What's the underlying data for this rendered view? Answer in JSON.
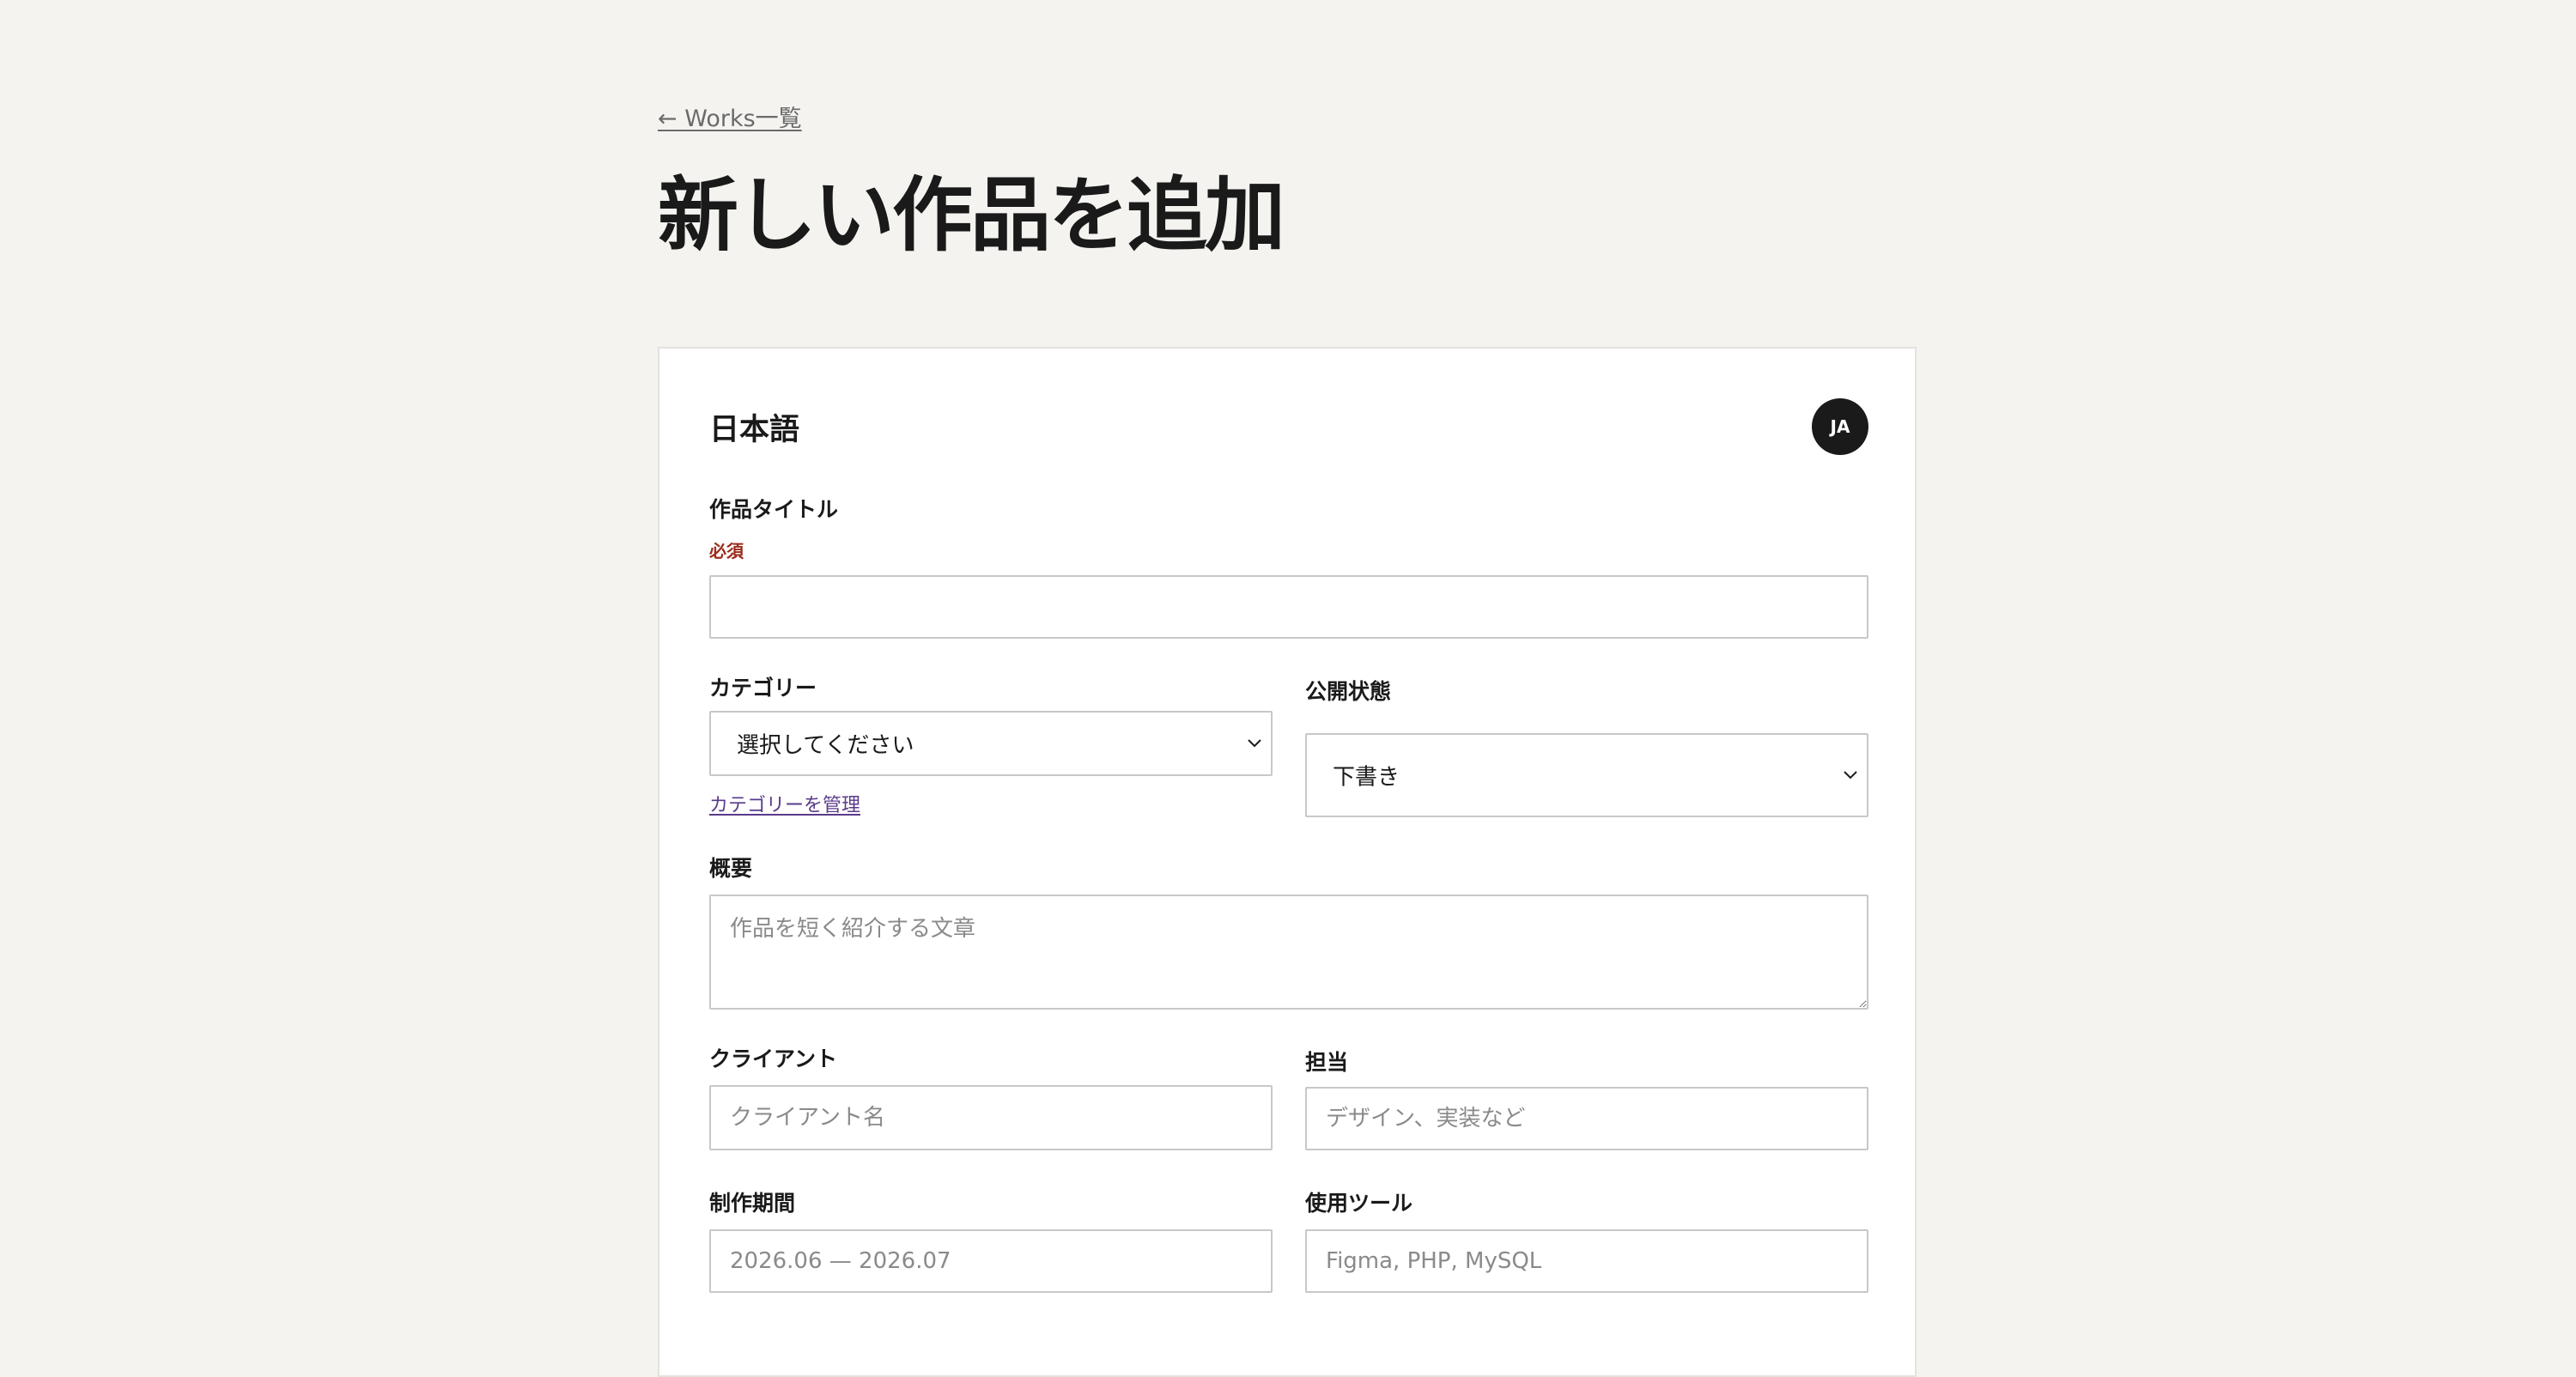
{
  "back_link": "← Works一覧",
  "page_title": "新しい作品を追加",
  "card": {
    "heading": "日本語",
    "lang_badge": "JA"
  },
  "fields": {
    "title": {
      "label": "作品タイトル",
      "required": "必須",
      "value": ""
    },
    "category": {
      "label": "カテゴリー",
      "value": "選択してください",
      "manage_link": "カテゴリーを管理"
    },
    "status": {
      "label": "公開状態",
      "value": "下書き"
    },
    "summary": {
      "label": "概要",
      "placeholder": "作品を短く紹介する文章"
    },
    "client": {
      "label": "クライアント",
      "placeholder": "クライアント名"
    },
    "role": {
      "label": "担当",
      "placeholder": "デザイン、実装など"
    },
    "period": {
      "label": "制作期間",
      "placeholder": "2026.06 — 2026.07"
    },
    "tools": {
      "label": "使用ツール",
      "placeholder": "Figma, PHP, MySQL"
    }
  }
}
